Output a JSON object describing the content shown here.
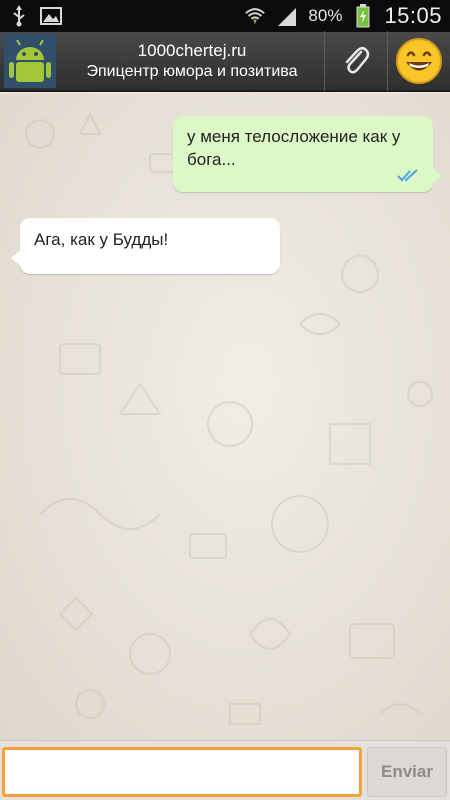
{
  "status_bar": {
    "battery_percent": "80%",
    "time": "15:05",
    "icons": [
      "usb-icon",
      "image-icon",
      "wifi-icon",
      "signal-icon",
      "battery-icon"
    ]
  },
  "header": {
    "title": "1000chertej.ru",
    "subtitle": "Эпицентр юмора и позитива",
    "icons": [
      "android-avatar-icon",
      "paperclip-icon",
      "smiley-icon"
    ]
  },
  "messages": [
    {
      "direction": "outgoing",
      "text": "у меня телосложение как у бога...",
      "status_icon": "double-check-icon"
    },
    {
      "direction": "incoming",
      "text": "Ага, как у Будды!"
    }
  ],
  "composer": {
    "value": "",
    "send_label": "Enviar"
  },
  "colors": {
    "outgoing_bubble": "#dcf8c6",
    "incoming_bubble": "#ffffff",
    "input_focus": "#f5a13a",
    "header": "#3a3a3a"
  }
}
